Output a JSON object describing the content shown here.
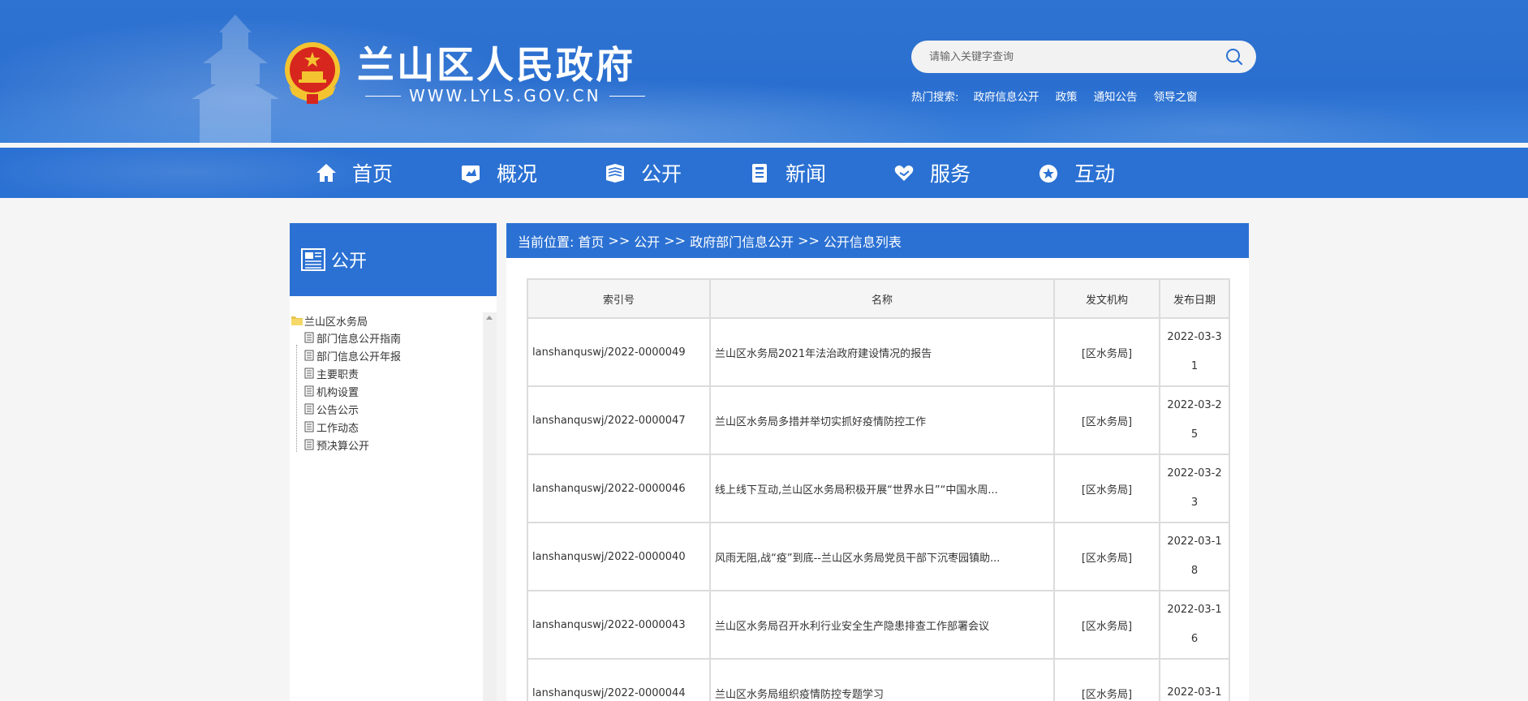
{
  "header": {
    "site_title": "兰山区人民政府",
    "site_url": "WWW.LYLS.GOV.CN",
    "search_placeholder": "请输入关键字查询",
    "hot_label": "热门搜索:",
    "hot_links": [
      "政府信息公开",
      "政策",
      "通知公告",
      "领导之窗"
    ]
  },
  "nav": {
    "items": [
      {
        "label": "首页",
        "icon": "home-icon"
      },
      {
        "label": "概况",
        "icon": "overview-icon"
      },
      {
        "label": "公开",
        "icon": "book-icon"
      },
      {
        "label": "新闻",
        "icon": "news-icon"
      },
      {
        "label": "服务",
        "icon": "heart-hand-icon"
      },
      {
        "label": "互动",
        "icon": "interact-icon"
      }
    ]
  },
  "sidebar": {
    "title": "公开",
    "tree_root": "兰山区水务局",
    "tree_items": [
      "部门信息公开指南",
      "部门信息公开年报",
      "主要职责",
      "机构设置",
      "公告公示",
      "工作动态",
      "预决算公开"
    ]
  },
  "breadcrumb": [
    "当前位置:",
    "首页",
    ">>",
    "公开",
    ">>",
    "政府部门信息公开",
    ">>",
    "公开信息列表"
  ],
  "table": {
    "headers": [
      "索引号",
      "名称",
      "发文机构",
      "发布日期"
    ],
    "rows": [
      {
        "index": "lanshanquswj/2022-0000049",
        "name": "兰山区水务局2021年法治政府建设情况的报告",
        "org": "[区水务局]",
        "date": "2022-03-31"
      },
      {
        "index": "lanshanquswj/2022-0000047",
        "name": "兰山区水务局多措并举切实抓好疫情防控工作",
        "org": "[区水务局]",
        "date": "2022-03-25"
      },
      {
        "index": "lanshanquswj/2022-0000046",
        "name": "线上线下互动,兰山区水务局积极开展“世界水日”“中国水周...",
        "org": "[区水务局]",
        "date": "2022-03-23"
      },
      {
        "index": "lanshanquswj/2022-0000040",
        "name": "风雨无阻,战“疫”到底--兰山区水务局党员干部下沉枣园镇助...",
        "org": "[区水务局]",
        "date": "2022-03-18"
      },
      {
        "index": "lanshanquswj/2022-0000043",
        "name": "兰山区水务局召开水利行业安全生产隐患排查工作部署会议",
        "org": "[区水务局]",
        "date": "2022-03-16"
      },
      {
        "index": "lanshanquswj/2022-0000044",
        "name": "兰山区水务局组织疫情防控专题学习",
        "org": "[区水务局]",
        "date": "2022-03-1"
      }
    ]
  },
  "colors": {
    "primary_blue": "#2b71d3",
    "emblem_red": "#d7261e",
    "emblem_gold": "#f4c430"
  }
}
